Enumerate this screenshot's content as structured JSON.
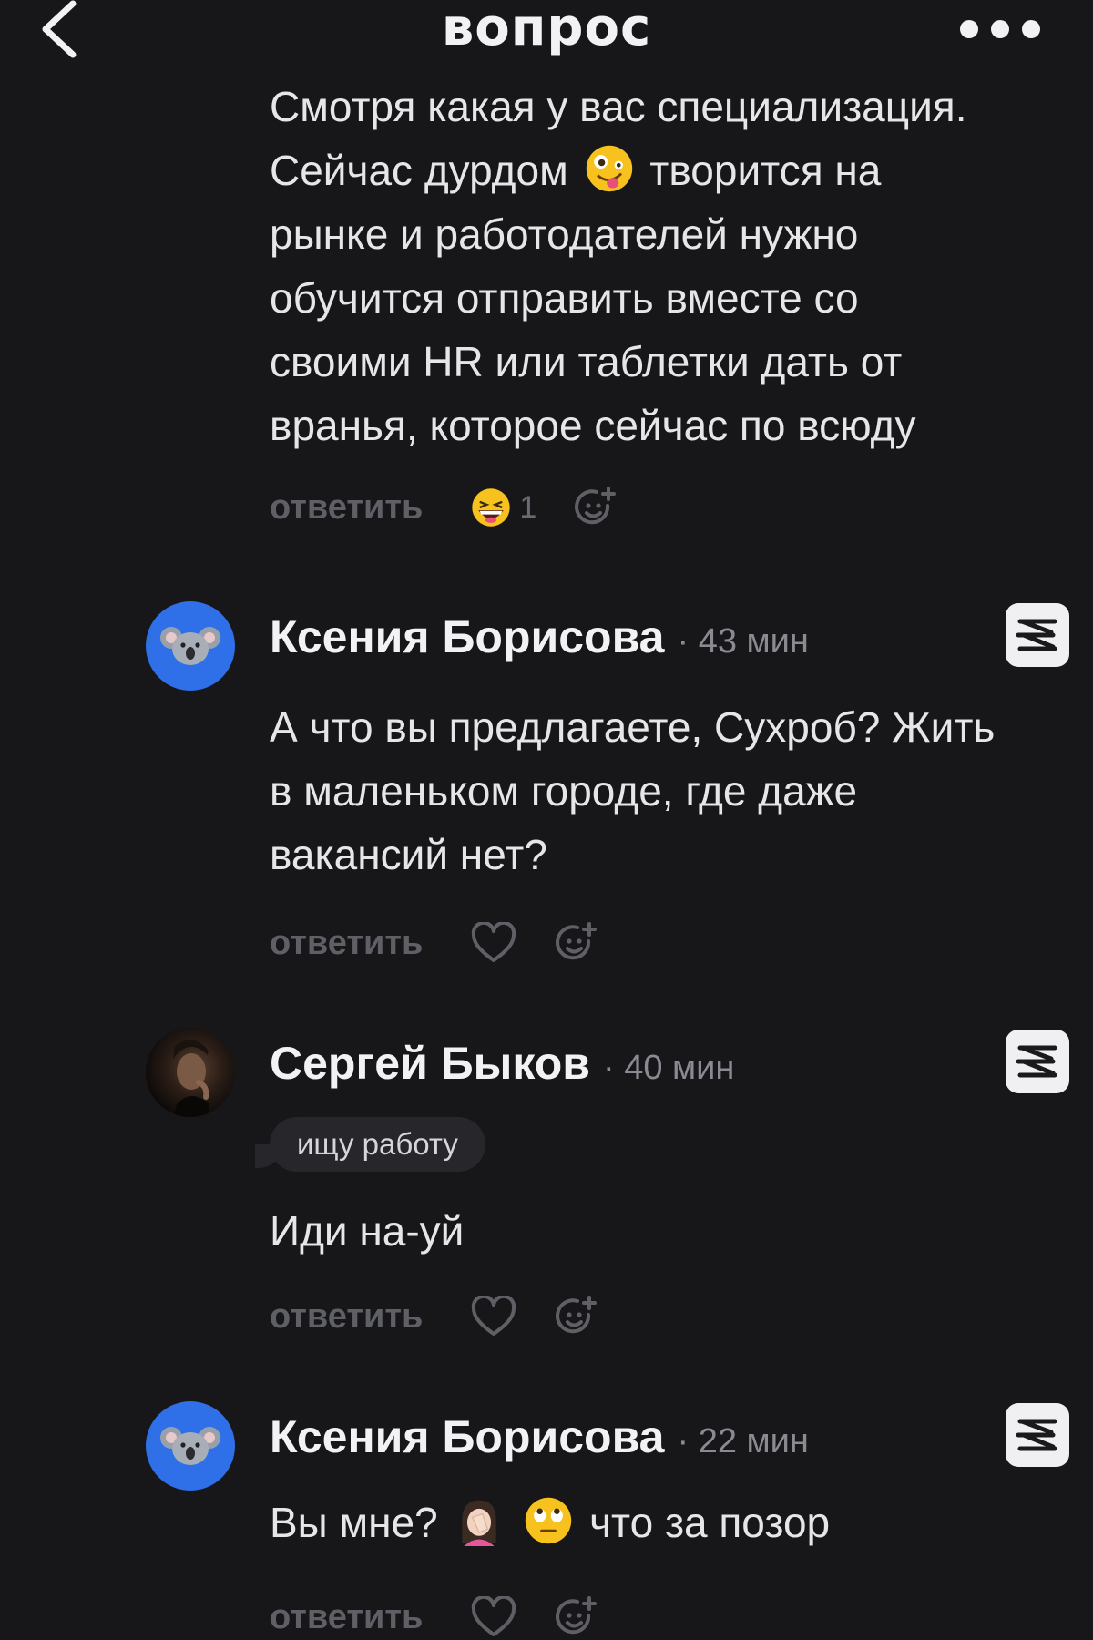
{
  "header": {
    "title": "вопрос",
    "back_icon": "chevron-left-icon",
    "more_icon": "more-dots-icon"
  },
  "top_comment": {
    "cut_line": "Смотря какая у вас специализация.",
    "line1_before": "Сейчас дурдом",
    "line1_after": "творится на",
    "line2": "рынке и работодателей нужно",
    "line3": "обучится отправить вместе со",
    "line4": "своими HR или таблетки дать от",
    "line5": "вранья, которое сейчас по всюду",
    "reply": "ответить",
    "reaction_count": "1"
  },
  "comments": [
    {
      "author": "Ксения Борисова",
      "time": "· 43 мин",
      "line1": "А что вы предлагаете, Сухроб? Жить",
      "line2": "в маленьком городе, где даже",
      "line3": "вакансий нет?",
      "reply": "ответить"
    },
    {
      "author": "Сергей Быков",
      "time": "· 40 мин",
      "tag": "ищу работу",
      "line1": "Иди на-уй",
      "reply": "ответить"
    },
    {
      "author": "Ксения Борисова",
      "time": "· 22 мин",
      "line1_before": "Вы мне?",
      "line1_after": "что за позор",
      "reply": "ответить"
    }
  ],
  "colors": {
    "background": "#17171a",
    "avatar_blue": "#2f6fe8",
    "muted": "#5f5f66"
  }
}
